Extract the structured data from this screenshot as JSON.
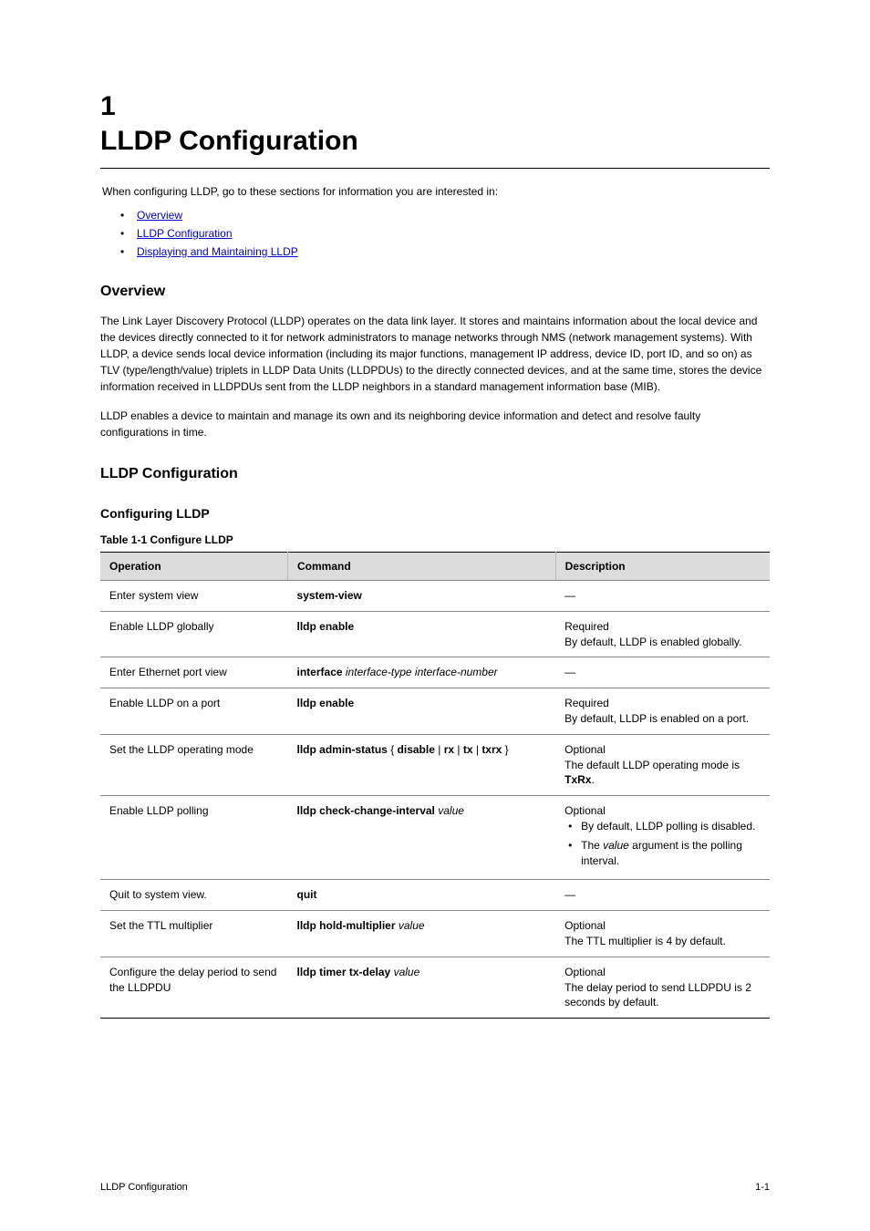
{
  "chapter_number": "1",
  "chapter_title": "LLDP Configuration",
  "intro": "When configuring LLDP, go to these sections for information you are interested in:",
  "links": [
    {
      "text": "Overview",
      "href": "#"
    },
    {
      "text": "LLDP Configuration",
      "href": "#"
    },
    {
      "text": "Displaying and Maintaining LLDP",
      "href": "#"
    }
  ],
  "sections": {
    "overview": {
      "heading": "Overview",
      "p1": "The Link Layer Discovery Protocol (LLDP) operates on the data link layer. It stores and maintains information about the local device and the devices directly connected to it for network administrators to manage networks through NMS (network management systems). With LLDP, a device sends local device information (including its major functions, management IP address, device ID, port ID, and so on) as TLV (type/length/value) triplets in LLDP Data Units (LLDPDUs) to the directly connected devices, and at the same time, stores the device information received in LLDPDUs sent from the LLDP neighbors in a standard management information base (MIB).",
      "p2": "LLDP enables a device to maintain and manage its own and its neighboring device information and detect and resolve faulty configurations in time."
    },
    "config": {
      "heading": "LLDP Configuration",
      "sub_heading": "Configuring LLDP",
      "table_caption": "Table 1-1 Configure LLDP",
      "columns": [
        "Operation",
        "Command",
        "Description"
      ],
      "rows": [
        {
          "op": "Enter system view",
          "cmd": "system-view",
          "desc": "—"
        },
        {
          "op": "Enable LLDP globally",
          "cmd": "lldp enable",
          "desc": "Required\nBy default, LLDP is enabled globally."
        },
        {
          "op": "Enter Ethernet port view",
          "cmd": "interface interface-type interface-number",
          "desc": "—"
        },
        {
          "op": "Enable LLDP on a port",
          "cmd": "lldp enable",
          "desc": "Required\nBy default, LLDP is enabled on a port."
        },
        {
          "op": "Set the LLDP operating mode",
          "cmd": "lldp admin-status { disable | rx | tx | txrx }",
          "desc": "Optional\nThe default LLDP operating mode is TxRx."
        },
        {
          "op": "Enable LLDP polling",
          "cmd": "lldp check-change-interval value",
          "desc_pre": "Optional",
          "desc_bullets": [
            "By default, LLDP polling is disabled.",
            "The value argument is the polling interval."
          ]
        },
        {
          "op": "Quit to system view.",
          "cmd": "quit",
          "desc": "—"
        },
        {
          "op": "Set the TTL multiplier",
          "cmd": "lldp hold-multiplier value",
          "desc": "Optional\nThe TTL multiplier is 4 by default."
        },
        {
          "op": "Configure the delay period to send the LLDPDU",
          "cmd": "lldp timer tx-delay value",
          "desc": "Optional\nThe delay period to send LLDPDU is 2 seconds by default."
        }
      ]
    }
  },
  "footer": {
    "left": "LLDP Configuration",
    "right": "1-1"
  }
}
